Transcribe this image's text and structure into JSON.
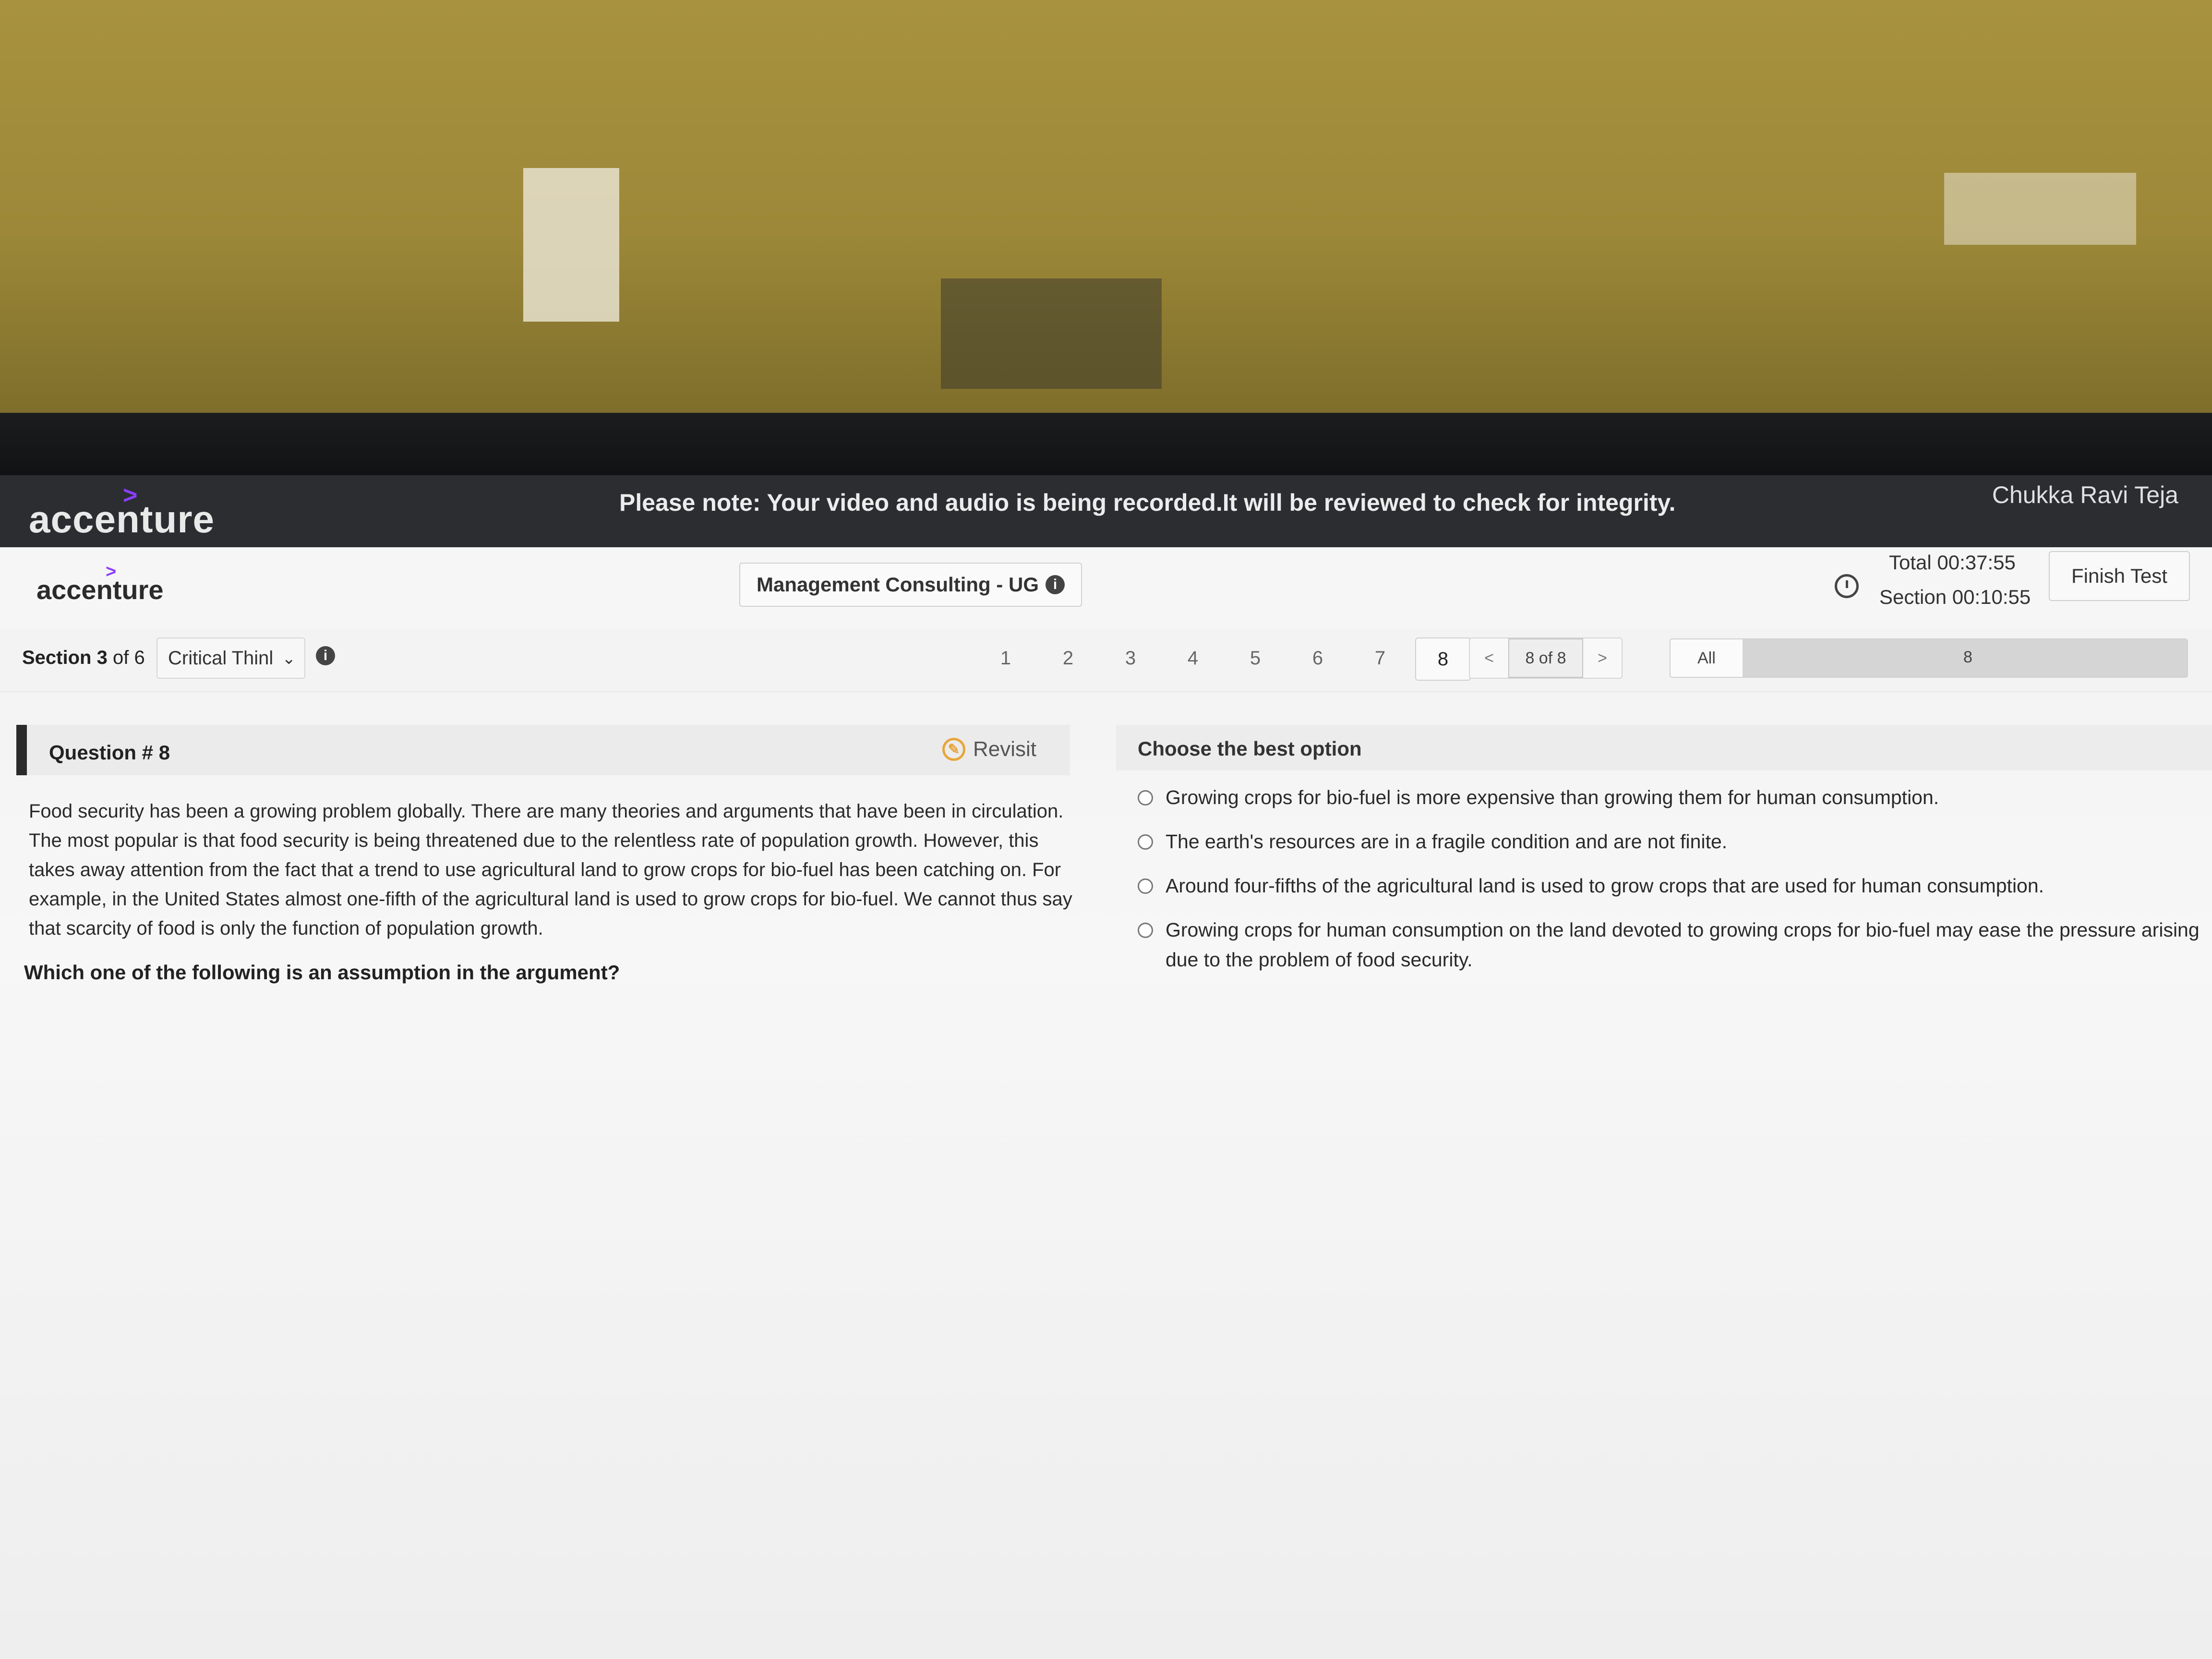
{
  "banner": {
    "logo": "accenture",
    "notice": "Please note: Your video and audio is being recorded.It will be reviewed to check for integrity.",
    "user": "Chukka Ravi Teja"
  },
  "header": {
    "logo": "accenture",
    "test_title": "Management Consulting - UG",
    "timer_total": "Total 00:37:55",
    "timer_section": "Section 00:10:55",
    "finish_label": "Finish Test"
  },
  "nav": {
    "section_prefix": "Section",
    "section_number": "3",
    "section_suffix": "of 6",
    "section_name": "Critical Thinl",
    "questions": [
      "1",
      "2",
      "3",
      "4",
      "5",
      "6",
      "7",
      "8"
    ],
    "current_question": "8",
    "prev": "<",
    "counter": "8 of 8",
    "next": ">",
    "filter_label": "All",
    "filter_count": "8"
  },
  "question": {
    "title": "Question # 8",
    "revisit_label": "Revisit",
    "passage": "Food security has been a growing problem globally. There are many theories and arguments that have been in circulation. The most popular is that food security is being threatened due to the relentless rate of population growth. However, this takes away attention from the fact that a trend to use agricultural land to grow crops for bio-fuel has been catching on. For example, in the United States almost one-fifth of the agricultural land is used to grow crops for bio-fuel. We cannot thus say that scarcity of food is only the function of population growth.",
    "prompt": "Which one of the following is an assumption in the argument?"
  },
  "answers": {
    "title": "Choose the best option",
    "options": [
      "Growing crops for bio-fuel is more expensive than growing them for human consumption.",
      "The earth's resources are in a fragile condition and are not finite.",
      "Around four-fifths of the agricultural land is used to grow crops that are used for human consumption.",
      "Growing crops for human consumption on the land devoted to growing crops for bio-fuel may ease the pressure arising due to the problem of food security."
    ]
  }
}
